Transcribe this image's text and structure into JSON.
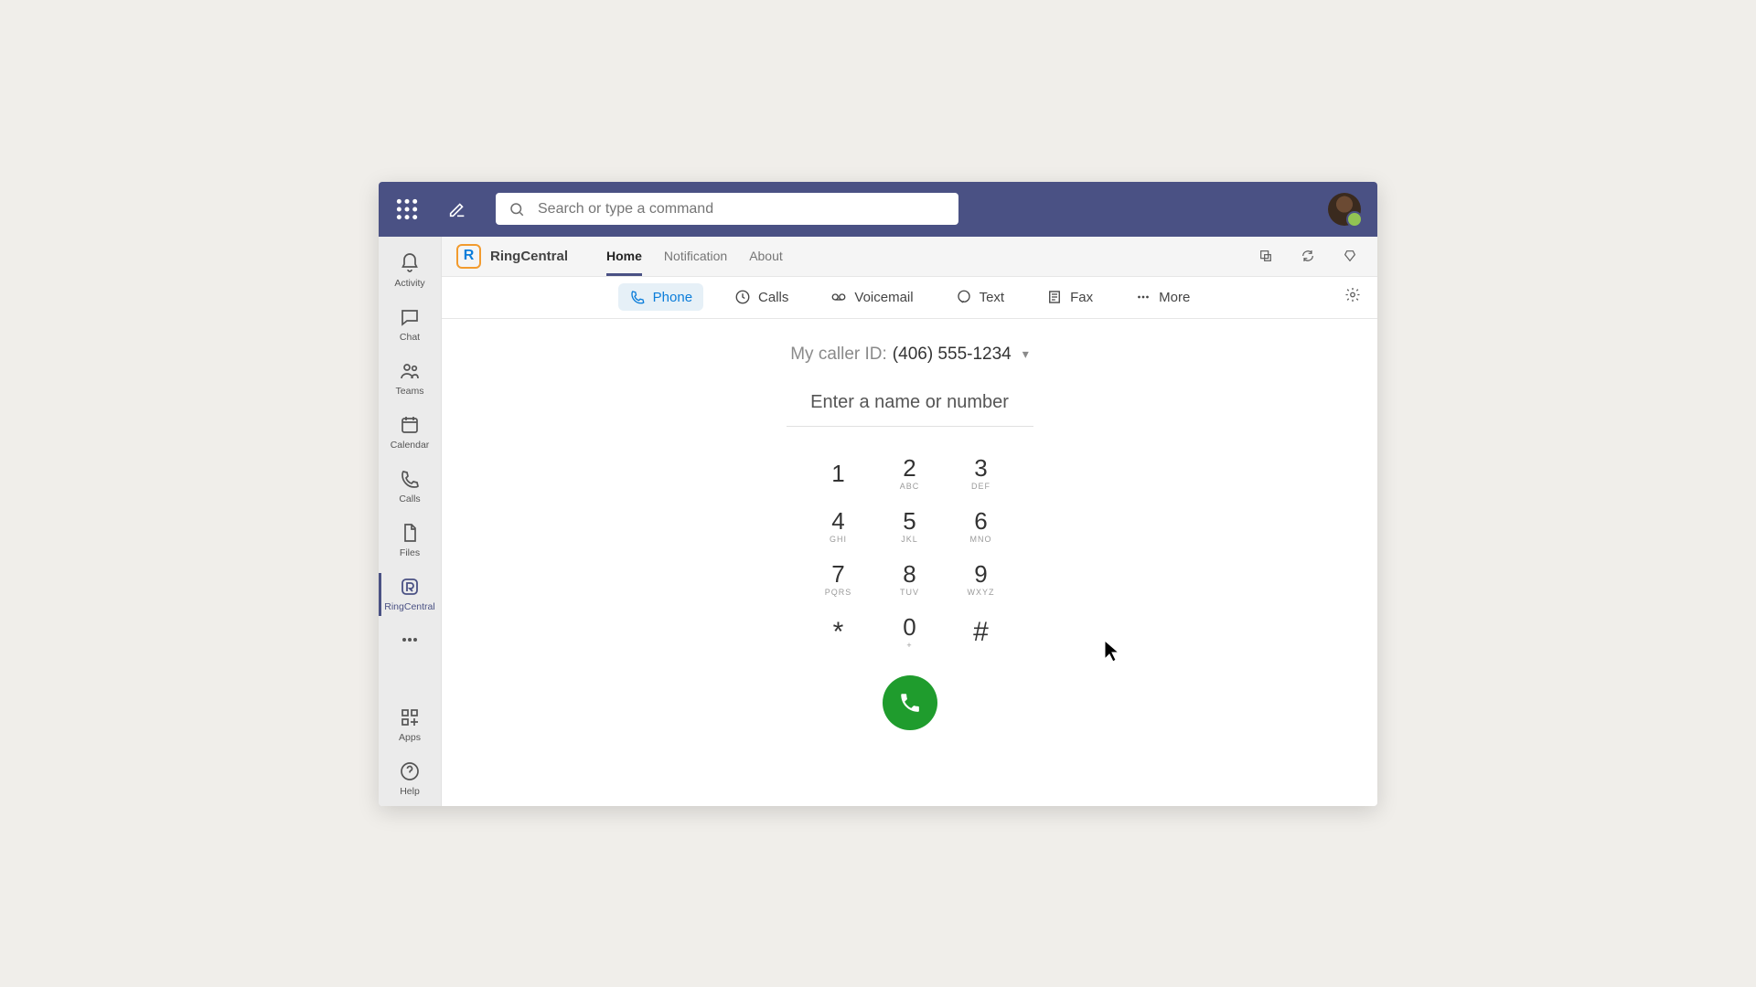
{
  "colors": {
    "topbar": "#4a5184",
    "accent": "#0b7dda",
    "call": "#1f9c2d"
  },
  "topbar": {
    "search_placeholder": "Search or type a command"
  },
  "rail": {
    "items": [
      {
        "id": "activity",
        "label": "Activity"
      },
      {
        "id": "chat",
        "label": "Chat"
      },
      {
        "id": "teams",
        "label": "Teams"
      },
      {
        "id": "calendar",
        "label": "Calendar"
      },
      {
        "id": "calls",
        "label": "Calls"
      },
      {
        "id": "files",
        "label": "Files"
      },
      {
        "id": "ringcentral",
        "label": "RingCentral",
        "active": true
      },
      {
        "id": "overflow",
        "label": ""
      }
    ],
    "bottom": [
      {
        "id": "apps",
        "label": "Apps"
      },
      {
        "id": "help",
        "label": "Help"
      }
    ]
  },
  "app_header": {
    "brand": "RingCentral",
    "tabs": [
      {
        "label": "Home",
        "active": true
      },
      {
        "label": "Notification"
      },
      {
        "label": "About"
      }
    ]
  },
  "subtabs": [
    {
      "icon": "phone",
      "label": "Phone",
      "active": true
    },
    {
      "icon": "clock",
      "label": "Calls"
    },
    {
      "icon": "voicemail",
      "label": "Voicemail"
    },
    {
      "icon": "text",
      "label": "Text"
    },
    {
      "icon": "fax",
      "label": "Fax"
    },
    {
      "icon": "more",
      "label": "More"
    }
  ],
  "dialer": {
    "caller_id_label": "My caller ID:",
    "caller_id_value": "(406) 555-1234",
    "input_placeholder": "Enter a name or number",
    "keys": [
      {
        "d": "1",
        "l": ""
      },
      {
        "d": "2",
        "l": "ABC"
      },
      {
        "d": "3",
        "l": "DEF"
      },
      {
        "d": "4",
        "l": "GHI"
      },
      {
        "d": "5",
        "l": "JKL"
      },
      {
        "d": "6",
        "l": "MNO"
      },
      {
        "d": "7",
        "l": "PQRS"
      },
      {
        "d": "8",
        "l": "TUV"
      },
      {
        "d": "9",
        "l": "WXYZ"
      },
      {
        "d": "*",
        "l": "",
        "sym": true
      },
      {
        "d": "0",
        "l": "+"
      },
      {
        "d": "#",
        "l": "",
        "sym": true
      }
    ]
  }
}
